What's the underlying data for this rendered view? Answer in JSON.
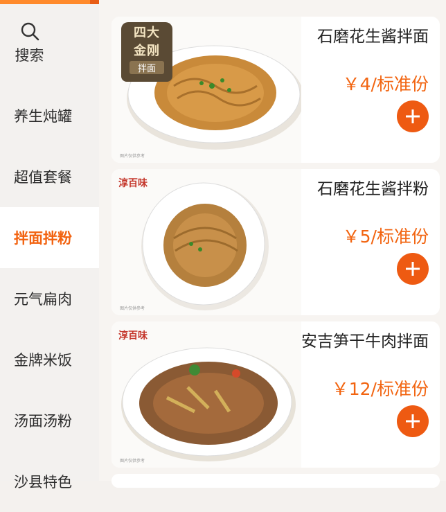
{
  "sidebar": {
    "search_label": "搜索",
    "items": [
      {
        "label": "养生炖罐"
      },
      {
        "label": "超值套餐"
      },
      {
        "label": "拌面拌粉",
        "active": true
      },
      {
        "label": "元气扁肉"
      },
      {
        "label": "金牌米饭"
      },
      {
        "label": "汤面汤粉"
      },
      {
        "label": "沙县特色"
      }
    ]
  },
  "products": [
    {
      "name": "石磨花生酱拌面",
      "price": "￥4/标准份",
      "badge_line1": "四大",
      "badge_line2": "金刚",
      "badge_tag": "拌面",
      "caption": "图片仅供参考"
    },
    {
      "name": "石磨花生酱拌粉",
      "price": "￥5/标准份",
      "brand": "淳百味",
      "caption": "图片仅供参考"
    },
    {
      "name": "安吉笋干牛肉拌面",
      "price": "￥12/标准份",
      "brand": "淳百味",
      "caption": "图片仅供参考"
    }
  ],
  "colors": {
    "accent": "#ee5a12",
    "active_text": "#f2620f"
  }
}
